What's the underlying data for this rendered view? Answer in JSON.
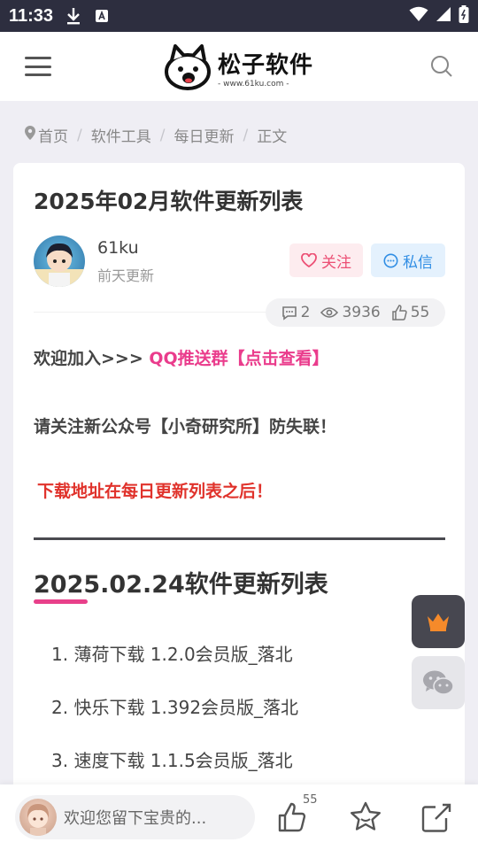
{
  "status_bar": {
    "time": "11:33"
  },
  "header": {
    "logo_title": "松子软件",
    "logo_sub": "- www.61ku.com -"
  },
  "breadcrumb": [
    "首页",
    "软件工具",
    "每日更新",
    "正文"
  ],
  "article": {
    "title": "2025年02月软件更新列表",
    "author": "61ku",
    "updated": "前天更新",
    "follow_label": "关注",
    "message_label": "私信",
    "stats": {
      "comments": "2",
      "views": "3936",
      "likes": "55"
    },
    "para1_prefix": "欢迎加入>>> ",
    "para1_link": "QQ推送群【点击查看】",
    "para2": "请关注新公众号【小奇研究所】防失联！",
    "para3": "下载地址在每日更新列表之后！",
    "section_title": "2025.02.24软件更新列表",
    "list": [
      "1. 薄荷下载 1.2.0会员版_落北",
      "2. 快乐下载 1.392会员版_落北",
      "3. 速度下载 1.1.5会员版_落北"
    ]
  },
  "bottom_bar": {
    "comment_placeholder": "欢迎您留下宝贵的...",
    "like_count": "55"
  },
  "colors": {
    "accent_pink": "#ea3c8c",
    "accent_red": "#e0322b",
    "follow": "#ec4f74",
    "message": "#2f8de4"
  }
}
